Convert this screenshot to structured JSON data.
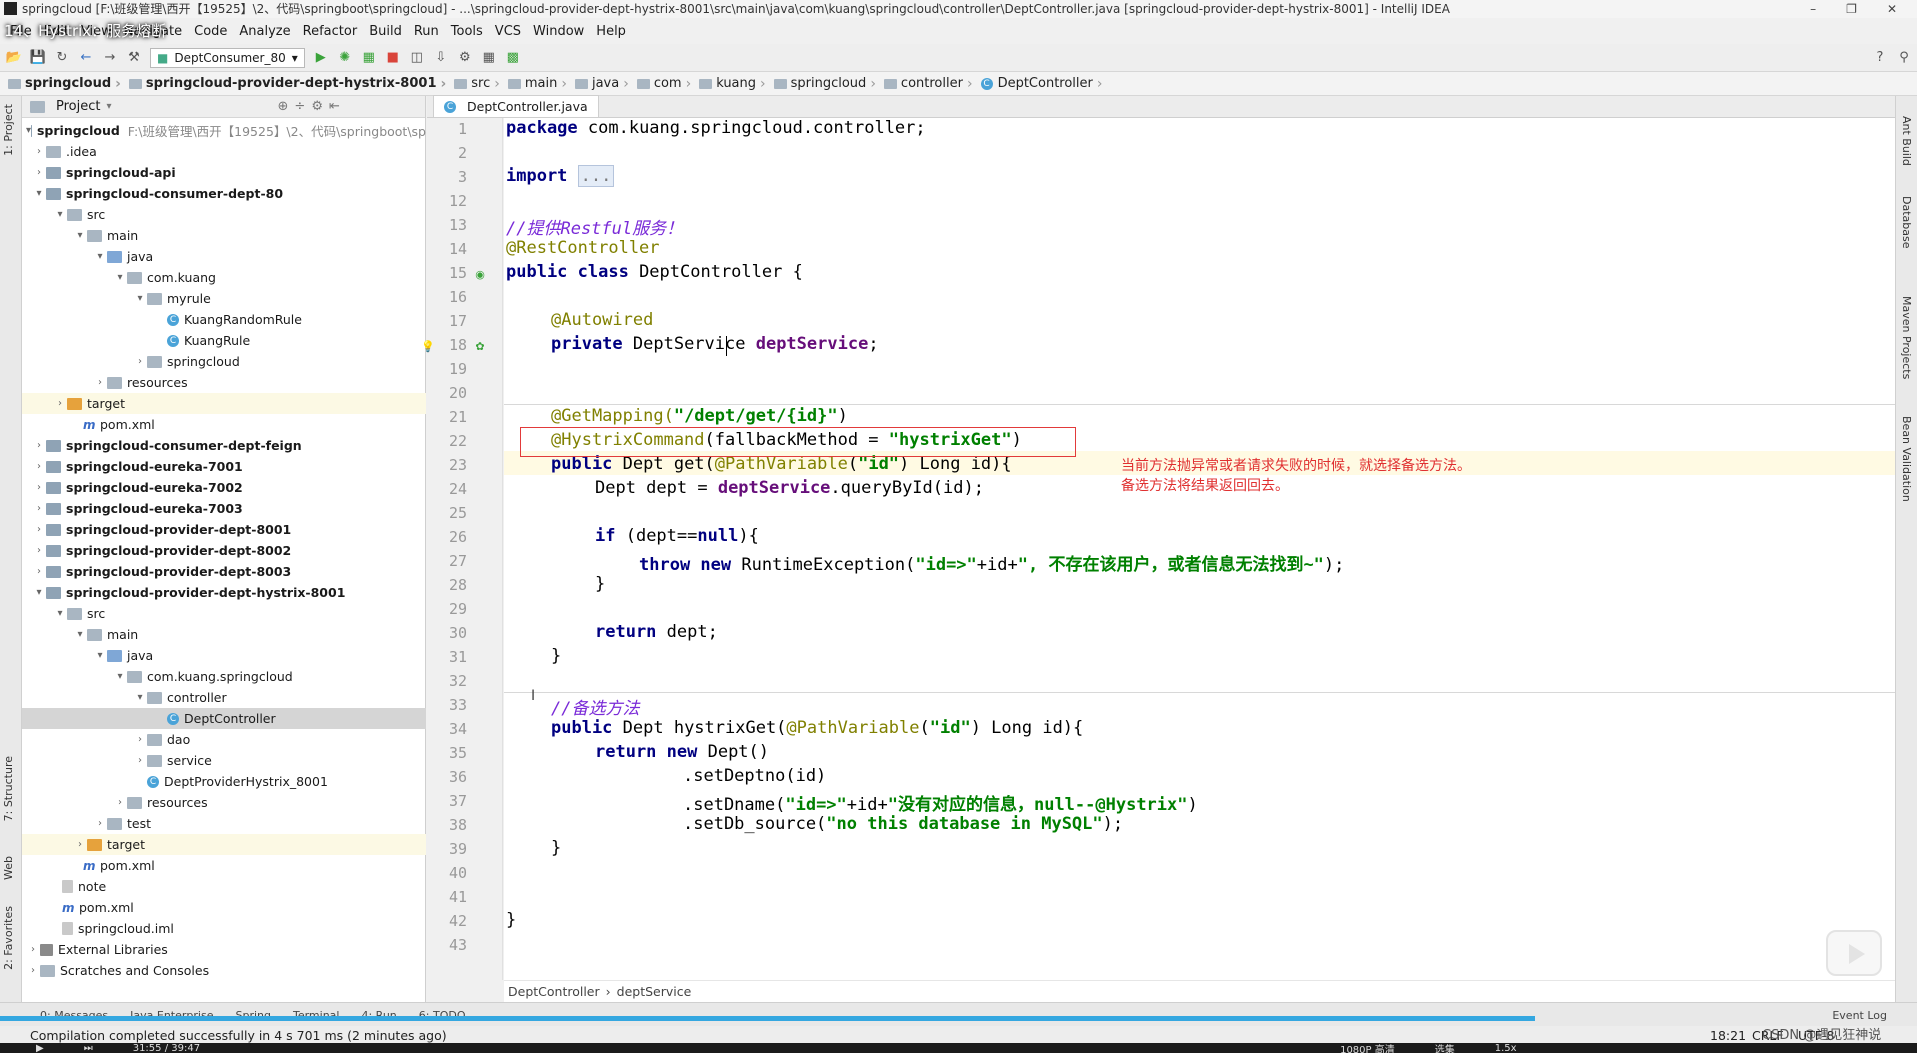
{
  "window": {
    "title": "springcloud [F:\\班级管理\\西开【19525】\\2、代码\\springboot\\springcloud] - ...\\springcloud-provider-dept-hystrix-8001\\src\\main\\java\\com\\kuang\\springcloud\\controller\\DeptController.java [springcloud-provider-dept-hystrix-8001] - IntelliJ IDEA",
    "video_title": "14、Hystrix：服务熔断"
  },
  "menu": [
    "File",
    "Edit",
    "View",
    "Navigate",
    "Code",
    "Analyze",
    "Refactor",
    "Build",
    "Run",
    "Tools",
    "VCS",
    "Window",
    "Help"
  ],
  "toolbar": {
    "run_config": "DeptConsumer_80"
  },
  "nav": [
    "springcloud",
    "springcloud-provider-dept-hystrix-8001",
    "src",
    "main",
    "java",
    "com",
    "kuang",
    "springcloud",
    "controller",
    "DeptController"
  ],
  "left_tabs": {
    "project": "1: Project",
    "structure": "7: Structure",
    "web": "Web",
    "favorites": "2: Favorites"
  },
  "right_tabs": {
    "ant": "Ant Build",
    "database": "Database",
    "maven": "Maven Projects",
    "bean": "Bean Validation"
  },
  "project": {
    "header": "Project",
    "root_name": "springcloud",
    "root_path": "F:\\班级管理\\西开【19525】\\2、代码\\springboot\\sp",
    "tree": [
      {
        "label": ".idea"
      },
      {
        "label": "springcloud-api"
      },
      {
        "label": "springcloud-consumer-dept-80"
      },
      {
        "label": "src"
      },
      {
        "label": "main"
      },
      {
        "label": "java"
      },
      {
        "label": "com.kuang"
      },
      {
        "label": "myrule"
      },
      {
        "label": "KuangRandomRule"
      },
      {
        "label": "KuangRule"
      },
      {
        "label": "springcloud"
      },
      {
        "label": "resources"
      },
      {
        "label": "target"
      },
      {
        "label": "pom.xml"
      },
      {
        "label": "springcloud-consumer-dept-feign"
      },
      {
        "label": "springcloud-eureka-7001"
      },
      {
        "label": "springcloud-eureka-7002"
      },
      {
        "label": "springcloud-eureka-7003"
      },
      {
        "label": "springcloud-provider-dept-8001"
      },
      {
        "label": "springcloud-provider-dept-8002"
      },
      {
        "label": "springcloud-provider-dept-8003"
      },
      {
        "label": "springcloud-provider-dept-hystrix-8001"
      },
      {
        "label": "src"
      },
      {
        "label": "main"
      },
      {
        "label": "java"
      },
      {
        "label": "com.kuang.springcloud"
      },
      {
        "label": "controller"
      },
      {
        "label": "DeptController"
      },
      {
        "label": "dao"
      },
      {
        "label": "service"
      },
      {
        "label": "DeptProviderHystrix_8001"
      },
      {
        "label": "resources"
      },
      {
        "label": "test"
      },
      {
        "label": "target"
      },
      {
        "label": "pom.xml"
      },
      {
        "label": "note"
      },
      {
        "label": "pom.xml"
      },
      {
        "label": "springcloud.iml"
      },
      {
        "label": "External Libraries"
      },
      {
        "label": "Scratches and Consoles"
      }
    ]
  },
  "editor": {
    "tab": "DeptController.java",
    "line_numbers": [
      "1",
      "2",
      "3",
      "12",
      "13",
      "14",
      "15",
      "16",
      "17",
      "18",
      "19",
      "20",
      "21",
      "22",
      "23",
      "24",
      "25",
      "26",
      "27",
      "28",
      "29",
      "30",
      "31",
      "32",
      "33",
      "34",
      "35",
      "36",
      "37",
      "38",
      "39",
      "40",
      "41",
      "42",
      "43"
    ],
    "code": {
      "l1_kw": "package",
      "l1_rest": " com.kuang.springcloud.controller;",
      "l3_kw": "import",
      "l3_fold": "...",
      "l13": "//提供Restful服务！",
      "l14": "@RestController",
      "l15_kw": "public class",
      "l15_rest": " DeptController {",
      "l17": "@Autowired",
      "l18_kw": "private",
      "l18_type": " DeptService ",
      "l18_field": "deptService",
      "l18_end": ";",
      "l21_ann": "@GetMapping(",
      "l21_str": "\"/dept/get/{id}\"",
      "l21_end": ")",
      "l22_ann": "@HystrixCommand",
      "l22_mid": "(fallbackMethod = ",
      "l22_str": "\"hystrixGet\"",
      "l22_end": ")",
      "l23_kw": "public",
      "l23_a": " Dept get(",
      "l23_ann": "@PathVariable",
      "l23_b": "(",
      "l23_str": "\"id\"",
      "l23_c": ") Long id){",
      "l24_a": "Dept dept = ",
      "l24_field": "deptService",
      "l24_b": ".queryById(id);",
      "l26_kw": "if",
      "l26_a": " (dept==",
      "l26_kw2": "null",
      "l26_b": "){",
      "l27_kw": "throw new",
      "l27_a": " RuntimeException(",
      "l27_str": "\"id=>\"",
      "l27_b": "+id+",
      "l27_str2": "\", 不存在该用户，或者信息无法找到~\"",
      "l27_c": ");",
      "l28": "}",
      "l30_kw": "return",
      "l30_a": " dept;",
      "l31": "}",
      "l33": "//备选方法",
      "l34_kw": "public",
      "l34_a": " Dept hystrixGet(",
      "l34_ann": "@PathVariable",
      "l34_b": "(",
      "l34_str": "\"id\"",
      "l34_c": ") Long id){",
      "l35_kw": "return new",
      "l35_a": " Dept()",
      "l36": ".setDeptno(id)",
      "l37_a": ".setDname(",
      "l37_str": "\"id=>\"",
      "l37_b": "+id+",
      "l37_str2": "\"没有对应的信息，null--@Hystrix\"",
      "l37_c": ")",
      "l38_a": ".setDb_source(",
      "l38_str": "\"no this database in MySQL\"",
      "l38_c": ");",
      "l39": "}",
      "l42": "}"
    },
    "annotation_note_1": "当前方法抛异常或者请求失败的时候，就选择备选方法。",
    "annotation_note_2": "备选方法将结果返回回去。",
    "breadcrumb": [
      "DeptController",
      "deptService"
    ]
  },
  "bottom_tabs": [
    "0: Messages",
    "Java Enterprise",
    "Spring",
    "Terminal",
    "4: Run",
    "6: TODO",
    "Event Log"
  ],
  "status": {
    "message": "Compilation completed successfully in 4 s 701 ms (2 minutes ago)",
    "position": "18:21",
    "encoding": "CRLF",
    "charset": "UTF-8"
  },
  "video": {
    "time": "31:55 / 39:47",
    "quality": "1080P 高清",
    "select": "选集",
    "speed": "1.5x"
  },
  "watermark": "CSDN @遇见狂神说"
}
